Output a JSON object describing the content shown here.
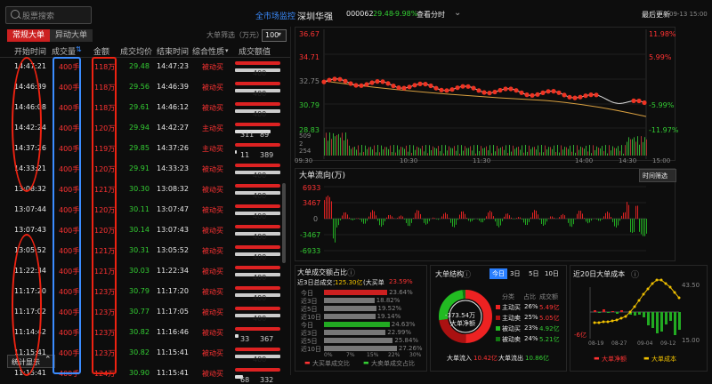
{
  "search": {
    "placeholder": "股票搜索"
  },
  "header": {
    "market_link": "全市场监控",
    "stock_name": "深圳华强",
    "stock_code": "000062",
    "price": "29.48",
    "change_pct": "-9.98%",
    "view_chart": "查看分时",
    "last_update_label": "最后更新",
    "last_update_time": "09-13 15:00"
  },
  "tabs": [
    {
      "label": "常规大单",
      "active": true
    },
    {
      "label": "异动大单",
      "active": false
    }
  ],
  "filter": {
    "label": "大单筛选（万元）",
    "value": "100"
  },
  "table": {
    "columns": [
      "开始时间",
      "成交量",
      "金额",
      "成交均价",
      "结束时间",
      "综合性质",
      "成交额值"
    ],
    "rows": [
      {
        "start": "14:47:21",
        "vol": "400手",
        "amt": "118万",
        "avg": "29.48",
        "end": "14:47:23",
        "nature": "被动买",
        "bar": {
          "a": "400",
          "b": ""
        }
      },
      {
        "start": "14:46:39",
        "vol": "400手",
        "amt": "118万",
        "avg": "29.56",
        "end": "14:46:39",
        "nature": "被动买",
        "bar": {
          "a": "400",
          "b": ""
        }
      },
      {
        "start": "14:46:08",
        "vol": "400手",
        "amt": "118万",
        "avg": "29.61",
        "end": "14:46:12",
        "nature": "被动买",
        "bar": {
          "a": "400",
          "b": ""
        }
      },
      {
        "start": "14:42:24",
        "vol": "400手",
        "amt": "120万",
        "avg": "29.94",
        "end": "14:42:27",
        "nature": "主动买",
        "bar": {
          "a": "311",
          "b": "89"
        }
      },
      {
        "start": "14:37:26",
        "vol": "400手",
        "amt": "119万",
        "avg": "29.85",
        "end": "14:37:26",
        "nature": "主动买",
        "bar": {
          "a": "11",
          "b": "389"
        }
      },
      {
        "start": "14:33:21",
        "vol": "400手",
        "amt": "120万",
        "avg": "29.91",
        "end": "14:33:23",
        "nature": "被动买",
        "bar": {
          "a": "400",
          "b": ""
        }
      },
      {
        "start": "13:08:32",
        "vol": "400手",
        "amt": "121万",
        "avg": "30.30",
        "end": "13:08:32",
        "nature": "被动买",
        "bar": {
          "a": "400",
          "b": ""
        }
      },
      {
        "start": "13:07:44",
        "vol": "400手",
        "amt": "120万",
        "avg": "30.11",
        "end": "13:07:47",
        "nature": "被动买",
        "bar": {
          "a": "400",
          "b": ""
        }
      },
      {
        "start": "13:07:43",
        "vol": "400手",
        "amt": "120万",
        "avg": "30.14",
        "end": "13:07:43",
        "nature": "被动买",
        "bar": {
          "a": "400",
          "b": ""
        }
      },
      {
        "start": "13:05:52",
        "vol": "400手",
        "amt": "121万",
        "avg": "30.31",
        "end": "13:05:52",
        "nature": "被动买",
        "bar": {
          "a": "400",
          "b": ""
        }
      },
      {
        "start": "11:22:34",
        "vol": "400手",
        "amt": "121万",
        "avg": "30.03",
        "end": "11:22:34",
        "nature": "被动买",
        "bar": {
          "a": "400",
          "b": ""
        }
      },
      {
        "start": "11:17:20",
        "vol": "400手",
        "amt": "123万",
        "avg": "30.79",
        "end": "11:17:20",
        "nature": "被动买",
        "bar": {
          "a": "400",
          "b": ""
        }
      },
      {
        "start": "11:17:02",
        "vol": "400手",
        "amt": "123万",
        "avg": "30.77",
        "end": "11:17:05",
        "nature": "被动买",
        "bar": {
          "a": "400",
          "b": ""
        }
      },
      {
        "start": "11:14:42",
        "vol": "400手",
        "amt": "123万",
        "avg": "30.82",
        "end": "11:16:46",
        "nature": "被动买",
        "bar": {
          "a": "33",
          "b": "367"
        }
      },
      {
        "start": "11:15:41",
        "vol": "400手",
        "amt": "123万",
        "avg": "30.82",
        "end": "11:15:41",
        "nature": "被动买",
        "bar": {
          "a": "400",
          "b": ""
        }
      },
      {
        "start": "11:15:41",
        "vol": "400手",
        "amt": "124万",
        "avg": "30.90",
        "end": "11:15:41",
        "nature": "被动买",
        "bar": {
          "a": "68",
          "b": "332"
        }
      }
    ]
  },
  "stats_button": "统计显示",
  "price_chart": {
    "y_left": [
      "36.67",
      "34.71",
      "32.75",
      "30.79",
      "28.83"
    ],
    "y_right": [
      "11.98%",
      "5.99%",
      "",
      "-5.99%",
      "-11.97%"
    ],
    "vol_labels": [
      "509",
      "2",
      "254"
    ],
    "x_ticks": [
      "09:30",
      "10:30",
      "11:30",
      "14:00",
      "14:30",
      "15:00"
    ],
    "x_ticks_bottom": [
      "10:00",
      "11:00",
      "13:30"
    ]
  },
  "flow_chart": {
    "title": "大单流向(万)",
    "button": "时间筛选",
    "y_labels": [
      "6933",
      "3467",
      "0",
      "-3467",
      "-6933"
    ]
  },
  "bottom_left": {
    "title": "大单成交额占比",
    "summary_prefix": "近3日总成交：",
    "summary_value": "125.30亿",
    "summary_mid": "(大买单",
    "summary_pct": "23.59%",
    "rows": [
      {
        "label": "今日",
        "pct": "23.64%"
      },
      {
        "label": "近3日",
        "pct": "18.82%"
      },
      {
        "label": "近5日",
        "pct": "19.52%"
      },
      {
        "label": "近10日",
        "pct": "19.14%"
      },
      {
        "label": "今日",
        "pct": "24.63%"
      },
      {
        "label": "近3日",
        "pct": "22.99%"
      },
      {
        "label": "近5日",
        "pct": "25.84%"
      },
      {
        "label": "近10日",
        "pct": "27.26%"
      }
    ],
    "x_ticks": [
      "0%",
      "7%",
      "15%",
      "22%",
      "30%"
    ],
    "legend": [
      "大买单成交比",
      "大卖单成交占比"
    ]
  },
  "bottom_mid": {
    "title": "大单结构",
    "tabs": [
      "今日",
      "3日",
      "5日",
      "10日"
    ],
    "center_value": "-373.54万",
    "center_label": "大单净额",
    "cols": [
      "分类",
      "占比",
      "成交额"
    ],
    "rows": [
      {
        "name": "主动买",
        "pct": "26%",
        "amt": "5.49亿"
      },
      {
        "name": "主动卖",
        "pct": "25%",
        "amt": "5.05亿"
      },
      {
        "name": "被动买",
        "pct": "23%",
        "amt": "4.92亿"
      },
      {
        "name": "被动卖",
        "pct": "24%",
        "amt": "5.21亿"
      }
    ],
    "inflow_label": "大单流入",
    "inflow": "10.42亿",
    "outflow_label": "大单流出",
    "outflow": "10.86亿"
  },
  "bottom_right": {
    "title": "近20日大单成本",
    "y_right": [
      "43.50",
      "",
      "15.00"
    ],
    "y_left": [
      "-6亿"
    ],
    "x_ticks": [
      "08-19",
      "08-27",
      "09-04",
      "09-12"
    ],
    "legend": [
      "大单净额",
      "大单成本"
    ]
  },
  "colors": {
    "up": "#ff3333",
    "down": "#33cc33",
    "accent": "#cc2020",
    "blue": "#3b8cff"
  }
}
